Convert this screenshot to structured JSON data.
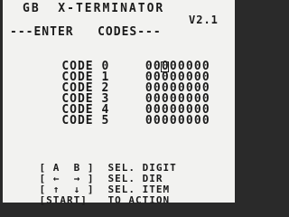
{
  "title": "GB  X-TERMINATOR",
  "version": "V2.1",
  "header": "---ENTER   CODES---",
  "codes": [
    {
      "label": "CODE 0",
      "value": "00000000"
    },
    {
      "label": "CODE 1",
      "value": "00000000"
    },
    {
      "label": "CODE 2",
      "value": "00000000"
    },
    {
      "label": "CODE 3",
      "value": "00000000"
    },
    {
      "label": "CODE 4",
      "value": "00000000"
    },
    {
      "label": "CODE 5",
      "value": "00000000"
    }
  ],
  "cursor": {
    "row": 0,
    "digit": 2
  },
  "help": [
    {
      "key": "[ A  B ]",
      "action": "SEL. DIGIT"
    },
    {
      "key": "[ ←  → ]",
      "action": "SEL. DIR"
    },
    {
      "key": "[ ↑  ↓ ]",
      "action": "SEL. ITEM"
    },
    {
      "key": "[START]",
      "action": "TO ACTION"
    }
  ]
}
